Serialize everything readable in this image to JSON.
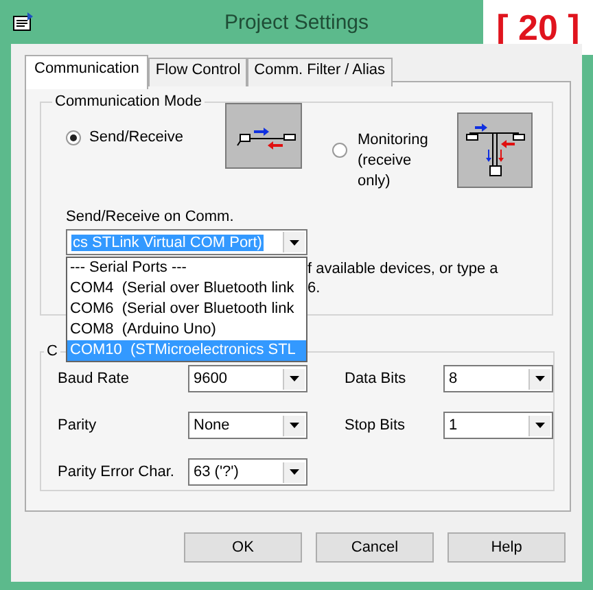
{
  "window": {
    "title": "Project Settings"
  },
  "annotation": {
    "text": "[ 20 ]"
  },
  "tabs": [
    {
      "label": "Communication",
      "selected": true
    },
    {
      "label": "Flow Control",
      "selected": false
    },
    {
      "label": "Comm. Filter / Alias",
      "selected": false
    }
  ],
  "communication_mode": {
    "title": "Communication Mode",
    "options": [
      {
        "label": "Send/Receive",
        "selected": true,
        "kind": "send-receive"
      },
      {
        "label": "Monitoring (receive only)",
        "selected": false,
        "kind": "monitoring"
      }
    ]
  },
  "comm_port": {
    "label": "Send/Receive on Comm.",
    "value": "cs STLink Virtual COM Port)",
    "hint_lines": [
      "f available devices, or type a",
      "6."
    ],
    "dropdown": [
      {
        "label": "--- Serial Ports ---",
        "selected": false
      },
      {
        "label": "COM4  (Serial over Bluetooth link",
        "selected": false
      },
      {
        "label": "COM6  (Serial over Bluetooth link",
        "selected": false
      },
      {
        "label": "COM8  (Arduino Uno)",
        "selected": false
      },
      {
        "label": "COM10  (STMicroelectronics STL",
        "selected": true
      }
    ]
  },
  "settings": {
    "title": "C",
    "fields": [
      {
        "label": "Baud Rate",
        "value": "9600"
      },
      {
        "label": "Data Bits",
        "value": "8"
      },
      {
        "label": "Parity",
        "value": "None"
      },
      {
        "label": "Stop Bits",
        "value": "1"
      },
      {
        "label": "Parity Error Char.",
        "value": "63 ('?')"
      }
    ]
  },
  "buttons": [
    "OK",
    "Cancel",
    "Help"
  ]
}
